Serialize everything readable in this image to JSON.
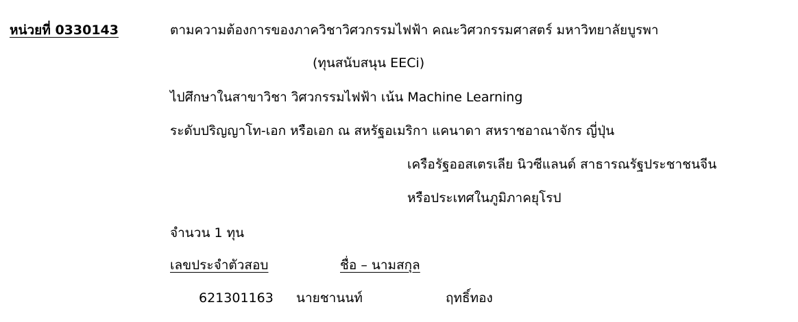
{
  "unit": {
    "label": "หน่วยที่ 0330143",
    "requirement": "ตามความต้องการของภาควิชาวิศวกรรมไฟฟ้า คณะวิศวกรรมศาสตร์ มหาวิทยาลัยบูรพา",
    "funding": "(ทุนสนับสนุน EECi)",
    "field": "ไปศึกษาในสาขาวิชา วิศวกรรมไฟฟ้า เน้น Machine Learning",
    "level_line": "ระดับปริญญาโท-เอก หรือเอก  ณ  สหรัฐอเมริกา แคนาดา สหราชอาณาจักร ญี่ปุ่น",
    "countries_line2": "เครือรัฐออสเตรเลีย นิวซีแลนด์ สาธารณรัฐประชาชนจีน",
    "countries_line3": "หรือประเทศในภูมิภาคยุโรป",
    "quota": "จำนวน  1 ทุน"
  },
  "table": {
    "header_id": "เลขประจำตัวสอบ",
    "header_name": "ชื่อ – นามสกุล",
    "rows": [
      {
        "id": "621301163",
        "first_name": "นายชานนท์",
        "last_name": "ฤทธิ์ทอง"
      }
    ]
  }
}
